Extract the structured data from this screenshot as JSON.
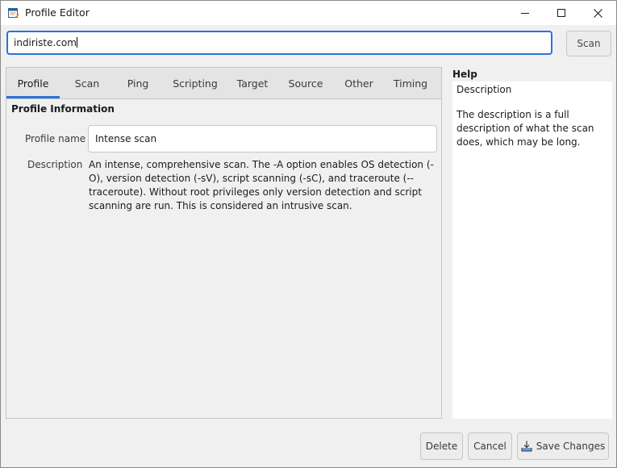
{
  "window": {
    "title": "Profile Editor"
  },
  "target": {
    "value": "indiriste.com"
  },
  "toolbar": {
    "scan_label": "Scan"
  },
  "tabs": [
    {
      "label": "Profile",
      "active": true
    },
    {
      "label": "Scan"
    },
    {
      "label": "Ping"
    },
    {
      "label": "Scripting"
    },
    {
      "label": "Target"
    },
    {
      "label": "Source"
    },
    {
      "label": "Other"
    },
    {
      "label": "Timing"
    }
  ],
  "profile": {
    "section_title": "Profile Information",
    "name_label": "Profile name",
    "name_value": "Intense scan",
    "description_label": "Description",
    "description_value": "An intense, comprehensive scan. The -A option enables OS detection (-O), version detection (-sV), script scanning (-sC), and traceroute (--traceroute). Without root privileges only version detection and script scanning are run. This is considered an intrusive scan."
  },
  "help": {
    "title": "Help",
    "heading": "Description",
    "body": "The description is a full description of what the scan does, which may be long."
  },
  "buttons": {
    "delete": "Delete",
    "cancel": "Cancel",
    "save": "Save Changes"
  },
  "colors": {
    "accent": "#2b73d8"
  }
}
